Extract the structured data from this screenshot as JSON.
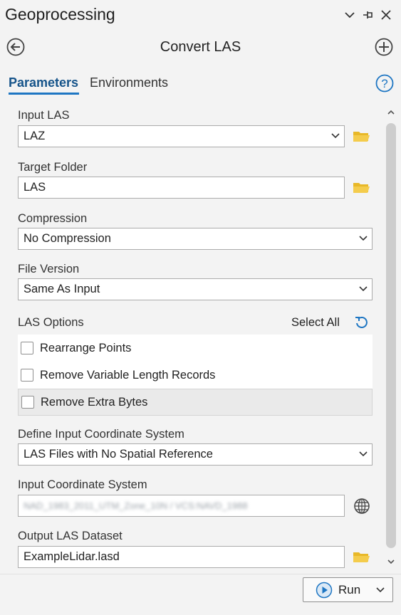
{
  "pane": {
    "title": "Geoprocessing",
    "tool_title": "Convert LAS",
    "tabs": [
      {
        "label": "Parameters",
        "active": true
      },
      {
        "label": "Environments",
        "active": false
      }
    ]
  },
  "params": {
    "input_las": {
      "label": "Input LAS",
      "value": "LAZ"
    },
    "target_folder": {
      "label": "Target Folder",
      "value": "LAS"
    },
    "compression": {
      "label": "Compression",
      "value": "No Compression"
    },
    "file_version": {
      "label": "File Version",
      "value": "Same As Input"
    },
    "las_options": {
      "label": "LAS Options",
      "select_all": "Select All",
      "items": [
        {
          "label": "Rearrange Points",
          "checked": false
        },
        {
          "label": "Remove Variable Length Records",
          "checked": false
        },
        {
          "label": "Remove Extra Bytes",
          "checked": false
        }
      ]
    },
    "define_cs": {
      "label": "Define Input Coordinate System",
      "value": "LAS Files with No Spatial Reference"
    },
    "input_cs": {
      "label": "Input Coordinate System",
      "value": "NAD_1983_2011_UTM_Zone_10N / VCS:NAVD_1988"
    },
    "output_dataset": {
      "label": "Output LAS Dataset",
      "value": "ExampleLidar.lasd"
    }
  },
  "footer": {
    "run_label": "Run"
  },
  "colors": {
    "accent": "#1e76c3",
    "folder": "#e8b828",
    "background": "#f3f3f3"
  },
  "icons": [
    "chevron-down-icon",
    "pin-icon",
    "close-icon",
    "back-arrow-icon",
    "add-icon",
    "help-icon",
    "folder-icon",
    "reset-icon",
    "globe-icon",
    "play-icon"
  ]
}
